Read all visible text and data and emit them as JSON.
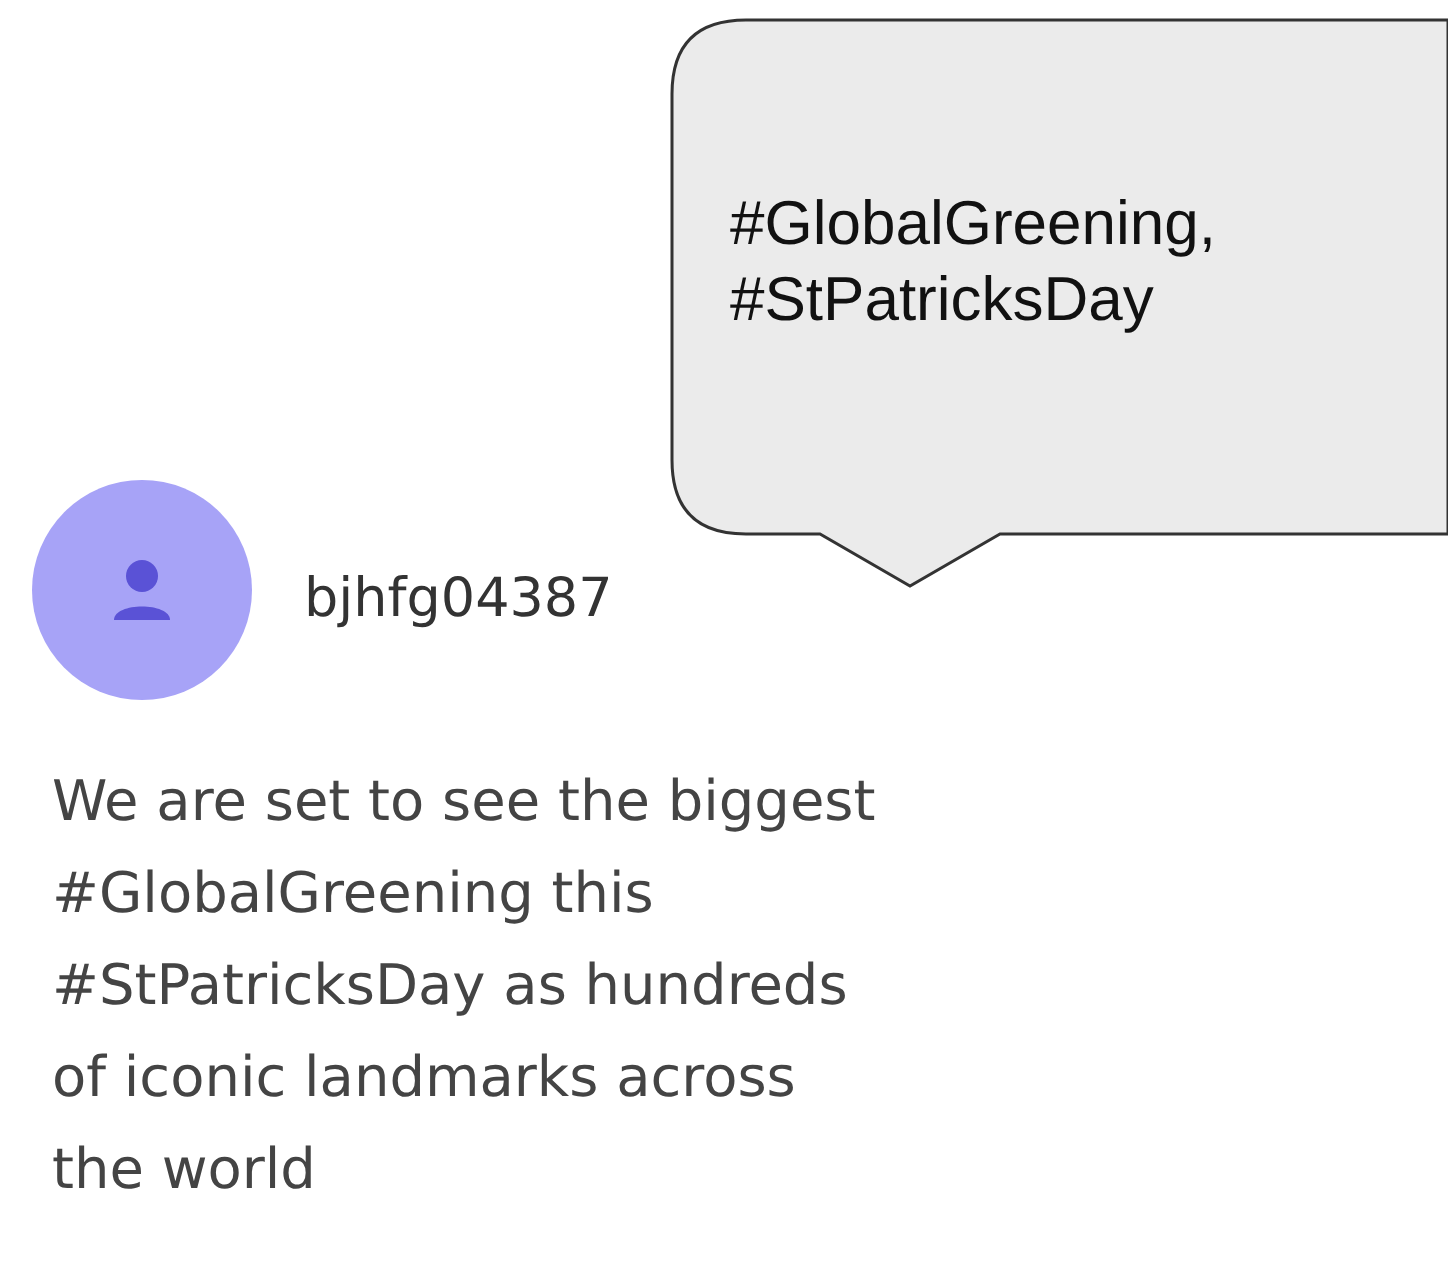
{
  "callout": {
    "text": "#GlobalGreening,\n#StPatricksDay"
  },
  "post": {
    "username": "bjhfg04387",
    "text": "We are set to see the biggest\n#GlobalGreening this\n#StPatricksDay as hundreds\nof iconic landmarks across\nthe world"
  }
}
